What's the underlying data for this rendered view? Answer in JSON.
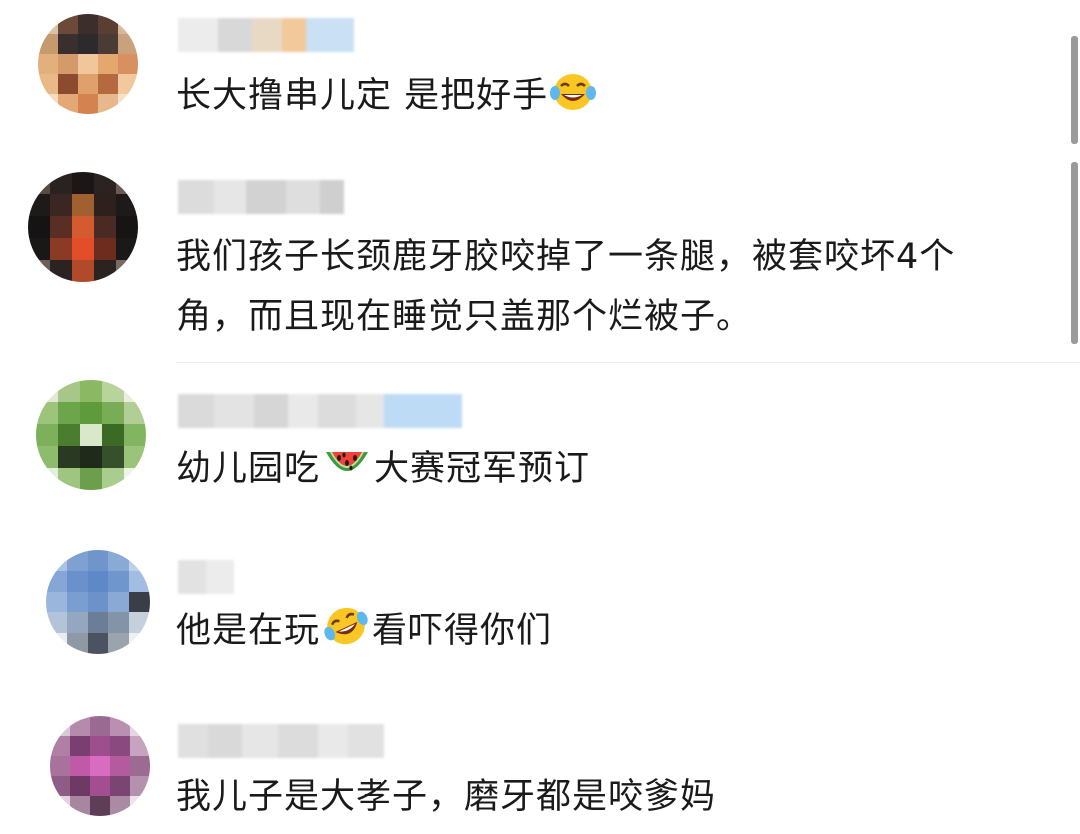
{
  "comments": [
    {
      "username": "",
      "text": "长大撸串儿定 是把好手",
      "emoji_after": "laughing-tears-emoji"
    },
    {
      "username": "",
      "text_line1": "我们孩子长颈鹿牙胶咬掉了一条腿，被套咬坏4个",
      "text_line2": "角，而且现在睡觉只盖那个烂被子。"
    },
    {
      "username": "",
      "text_before": "幼儿园吃",
      "emoji": "watermelon-emoji",
      "text_after": "大赛冠军预订"
    },
    {
      "username": "",
      "text_before": "他是在玩",
      "emoji": "rolling-laughing-emoji",
      "text_after": "看吓得你们"
    },
    {
      "username": "",
      "text": "我儿子是大孝子，磨牙都是咬爹妈"
    }
  ],
  "colors": {
    "text": "#1a1a1a",
    "scrollbar": "#9a9a9a",
    "divider": "#ececec",
    "username_blur": "#c9c9c9",
    "username_link_blur": "#aed3f2"
  }
}
